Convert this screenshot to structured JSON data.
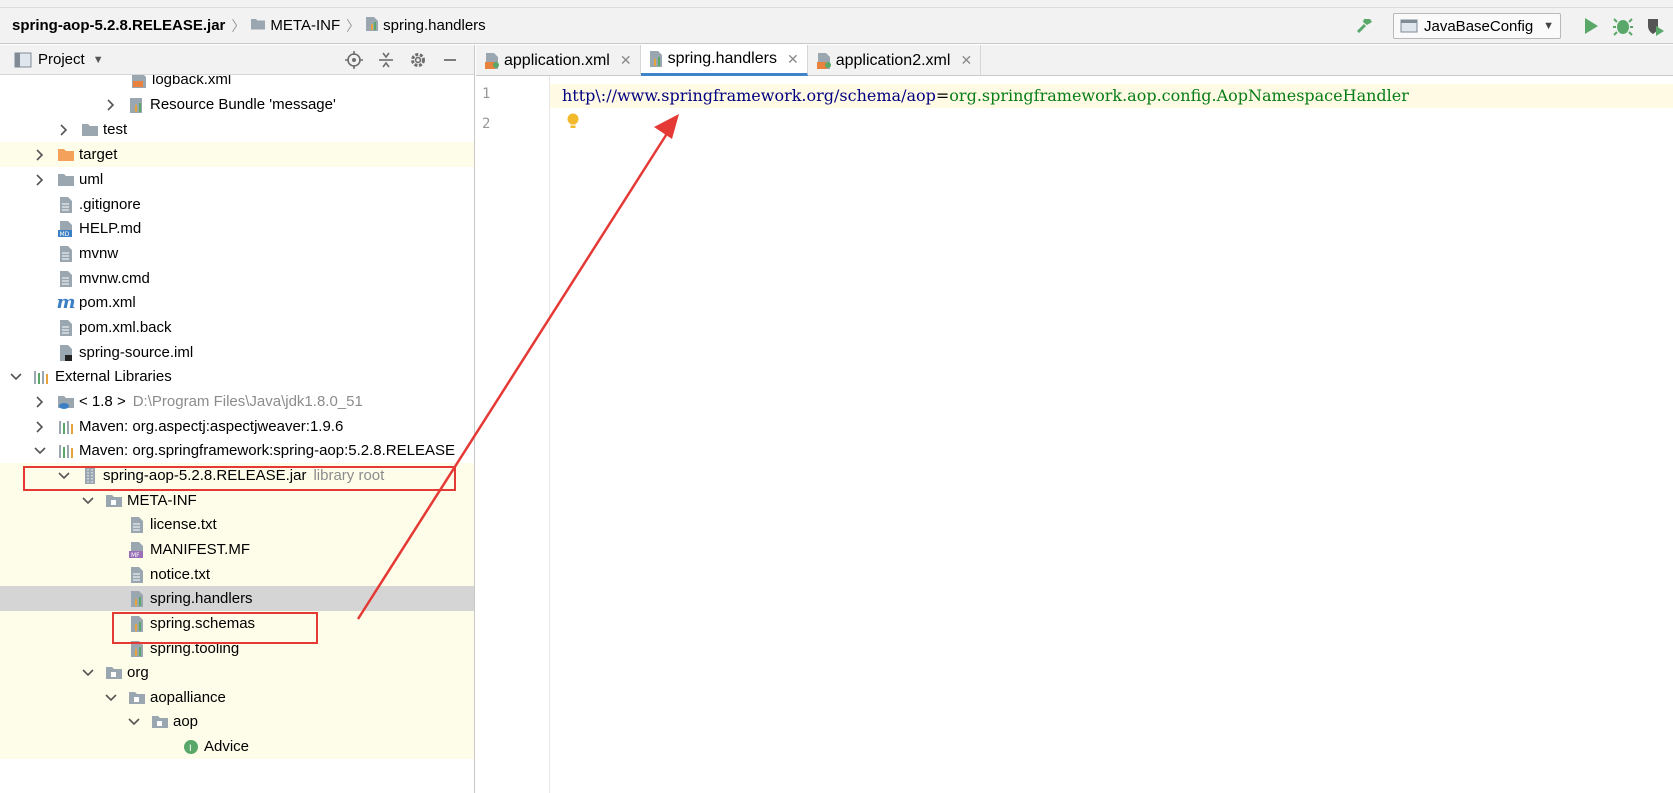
{
  "navbar": {
    "crumbs": [
      "spring-aop-5.2.8.RELEASE.jar",
      "META-INF",
      "spring.handlers"
    ]
  },
  "toolbar": {
    "run_config": "JavaBaseConfig"
  },
  "project_panel": {
    "title": "Project"
  },
  "tree": {
    "rows": [
      {
        "label": "logback.xml",
        "icon": "xml-file-icon"
      },
      {
        "label": "Resource Bundle 'message'",
        "icon": "resource-bundle-icon"
      },
      {
        "label": "test",
        "icon": "folder-icon"
      },
      {
        "label": "target",
        "icon": "folder-orange-icon"
      },
      {
        "label": "uml",
        "icon": "folder-icon"
      },
      {
        "label": ".gitignore",
        "icon": "text-file-icon"
      },
      {
        "label": "HELP.md",
        "icon": "markdown-file-icon"
      },
      {
        "label": "mvnw",
        "icon": "text-file-icon"
      },
      {
        "label": "mvnw.cmd",
        "icon": "text-file-icon"
      },
      {
        "label": "pom.xml",
        "icon": "maven-icon"
      },
      {
        "label": "pom.xml.back",
        "icon": "text-file-icon"
      },
      {
        "label": "spring-source.iml",
        "icon": "iml-file-icon"
      },
      {
        "label": "External Libraries",
        "icon": "libraries-icon"
      },
      {
        "label": "< 1.8 >",
        "extra": "D:\\Program Files\\Java\\jdk1.8.0_51",
        "icon": "jdk-icon"
      },
      {
        "label": "Maven: org.aspectj:aspectjweaver:1.9.6",
        "icon": "library-icon"
      },
      {
        "label": "Maven: org.springframework:spring-aop:5.2.8.RELEASE",
        "icon": "library-icon"
      },
      {
        "label": "spring-aop-5.2.8.RELEASE.jar",
        "extra": "library root",
        "icon": "jar-icon"
      },
      {
        "label": "META-INF",
        "icon": "package-icon"
      },
      {
        "label": "license.txt",
        "icon": "text-file-icon"
      },
      {
        "label": "MANIFEST.MF",
        "icon": "manifest-icon"
      },
      {
        "label": "notice.txt",
        "icon": "text-file-icon"
      },
      {
        "label": "spring.handlers",
        "icon": "properties-file-icon"
      },
      {
        "label": "spring.schemas",
        "icon": "properties-file-icon"
      },
      {
        "label": "spring.tooling",
        "icon": "properties-file-icon"
      },
      {
        "label": "org",
        "icon": "package-icon"
      },
      {
        "label": "aopalliance",
        "icon": "package-icon"
      },
      {
        "label": "aop",
        "icon": "package-icon"
      },
      {
        "label": "Advice",
        "icon": "interface-icon"
      }
    ]
  },
  "tabs": [
    {
      "label": "application.xml",
      "active": false
    },
    {
      "label": "spring.handlers",
      "active": true
    },
    {
      "label": "application2.xml",
      "active": false
    }
  ],
  "editor": {
    "line_numbers": [
      "1",
      "2"
    ],
    "key": "http\\://www.springframework.org/schema/aop",
    "eq": "=",
    "value": "org.springframework.aop.config.AopNamespaceHandler"
  },
  "colors": {
    "annotation": "#e53935",
    "selection": "#d5d5d5",
    "highlight_row": "#fefde9",
    "tab_underline": "#4083c9"
  }
}
